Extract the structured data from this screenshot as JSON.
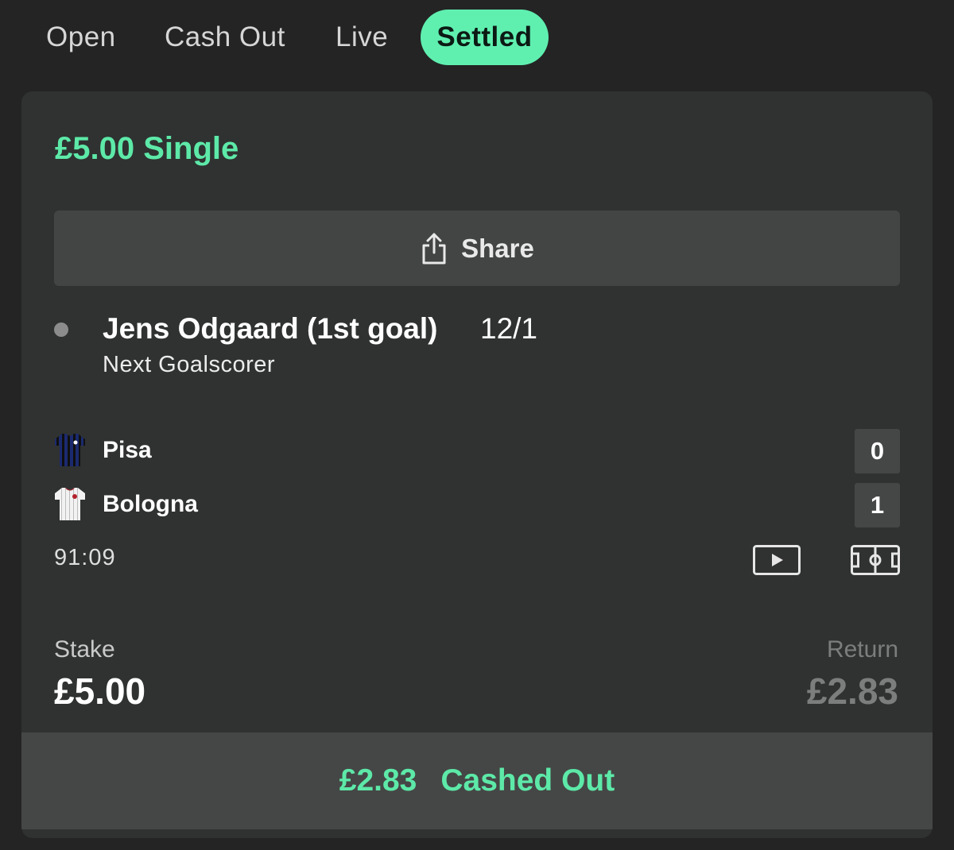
{
  "tabs": [
    {
      "label": "Open",
      "active": false
    },
    {
      "label": "Cash Out",
      "active": false
    },
    {
      "label": "Live",
      "active": false
    },
    {
      "label": "Settled",
      "active": true
    }
  ],
  "colors": {
    "accent": "#5de9a8",
    "active_tab_bg": "#5ff0b0",
    "card_bg": "#2f3231",
    "page_bg": "#242424"
  },
  "bet": {
    "title": "£5.00 Single",
    "share_label": "Share",
    "share_icon": "share-icon",
    "selection": {
      "name": "Jens Odgaard (1st goal)",
      "odds": "12/1",
      "market": "Next Goalscorer"
    },
    "teams": [
      {
        "name": "Pisa",
        "score": "0",
        "kit_icon": "striped-blue-black-shirt-icon"
      },
      {
        "name": "Bologna",
        "score": "1",
        "kit_icon": "white-striped-shirt-icon"
      }
    ],
    "match_clock": "91:09",
    "icons": [
      "play-video-icon",
      "pitch-tracker-icon"
    ],
    "stake_label": "Stake",
    "stake_value": "£5.00",
    "return_label": "Return",
    "return_value": "£2.83",
    "cashout_amount": "£2.83",
    "cashout_label": "Cashed Out"
  }
}
